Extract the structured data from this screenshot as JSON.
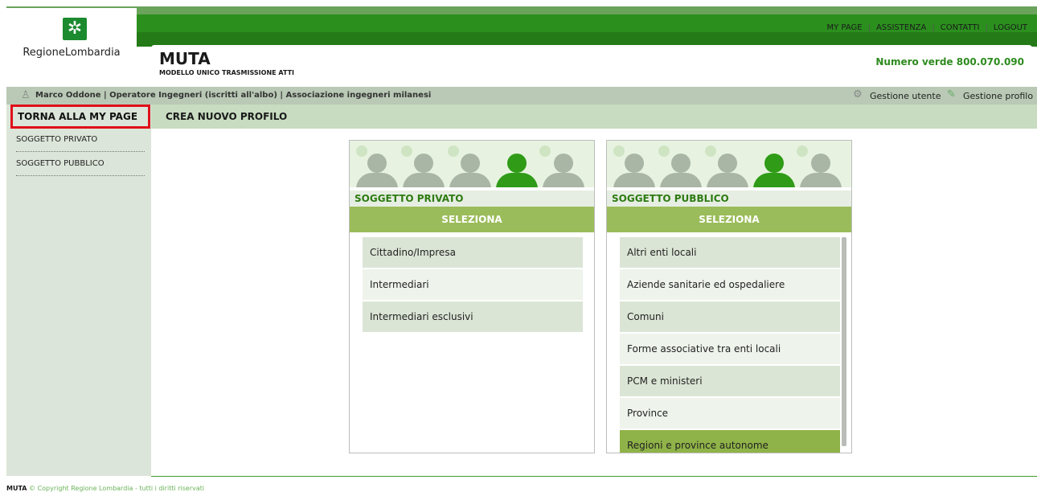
{
  "logo": {
    "text": "RegioneLombardia",
    "mark": "✲"
  },
  "topnav": {
    "items": [
      "MY PAGE",
      "ASSISTENZA",
      "CONTATTI",
      "LOGOUT"
    ],
    "separator": "|"
  },
  "app": {
    "title": "MUTA",
    "subtitle": "MODELLO UNICO TRASMISSIONE ATTI",
    "numero_verde": "Numero verde 800.070.090"
  },
  "userbar": {
    "text": "Marco Oddone | Operatore Ingegneri (iscritti all'albo) | Associazione ingegneri milanesi",
    "gestione_utente": "Gestione utente",
    "gestione_profilo": "Gestione profilo"
  },
  "sidebar": {
    "torna": "TORNA ALLA MY PAGE",
    "items": [
      "SOGGETTO PRIVATO",
      "SOGGETTO PUBBLICO"
    ]
  },
  "main": {
    "title": "CREA NUOVO PROFILO"
  },
  "panels": [
    {
      "title": "SOGGETTO PRIVATO",
      "select": "SELEZIONA",
      "options": [
        "Cittadino/Impresa",
        "Intermediari",
        "Intermediari esclusivi"
      ]
    },
    {
      "title": "SOGGETTO PUBBLICO",
      "select": "SELEZIONA",
      "options": [
        "Altri enti locali",
        "Aziende sanitarie ed ospedaliere",
        "Comuni",
        "Forme associative tra enti locali",
        "PCM e ministeri",
        "Province",
        "Regioni e province autonome"
      ]
    }
  ],
  "footer": {
    "app": "MUTA",
    "copyright": "© Copyright Regione Lombardia - tutti i diritti riservati"
  },
  "colors": {
    "brand_green": "#2b8f1e",
    "accent_green": "#9bbc5a",
    "highlight_red": "#e0101a"
  }
}
